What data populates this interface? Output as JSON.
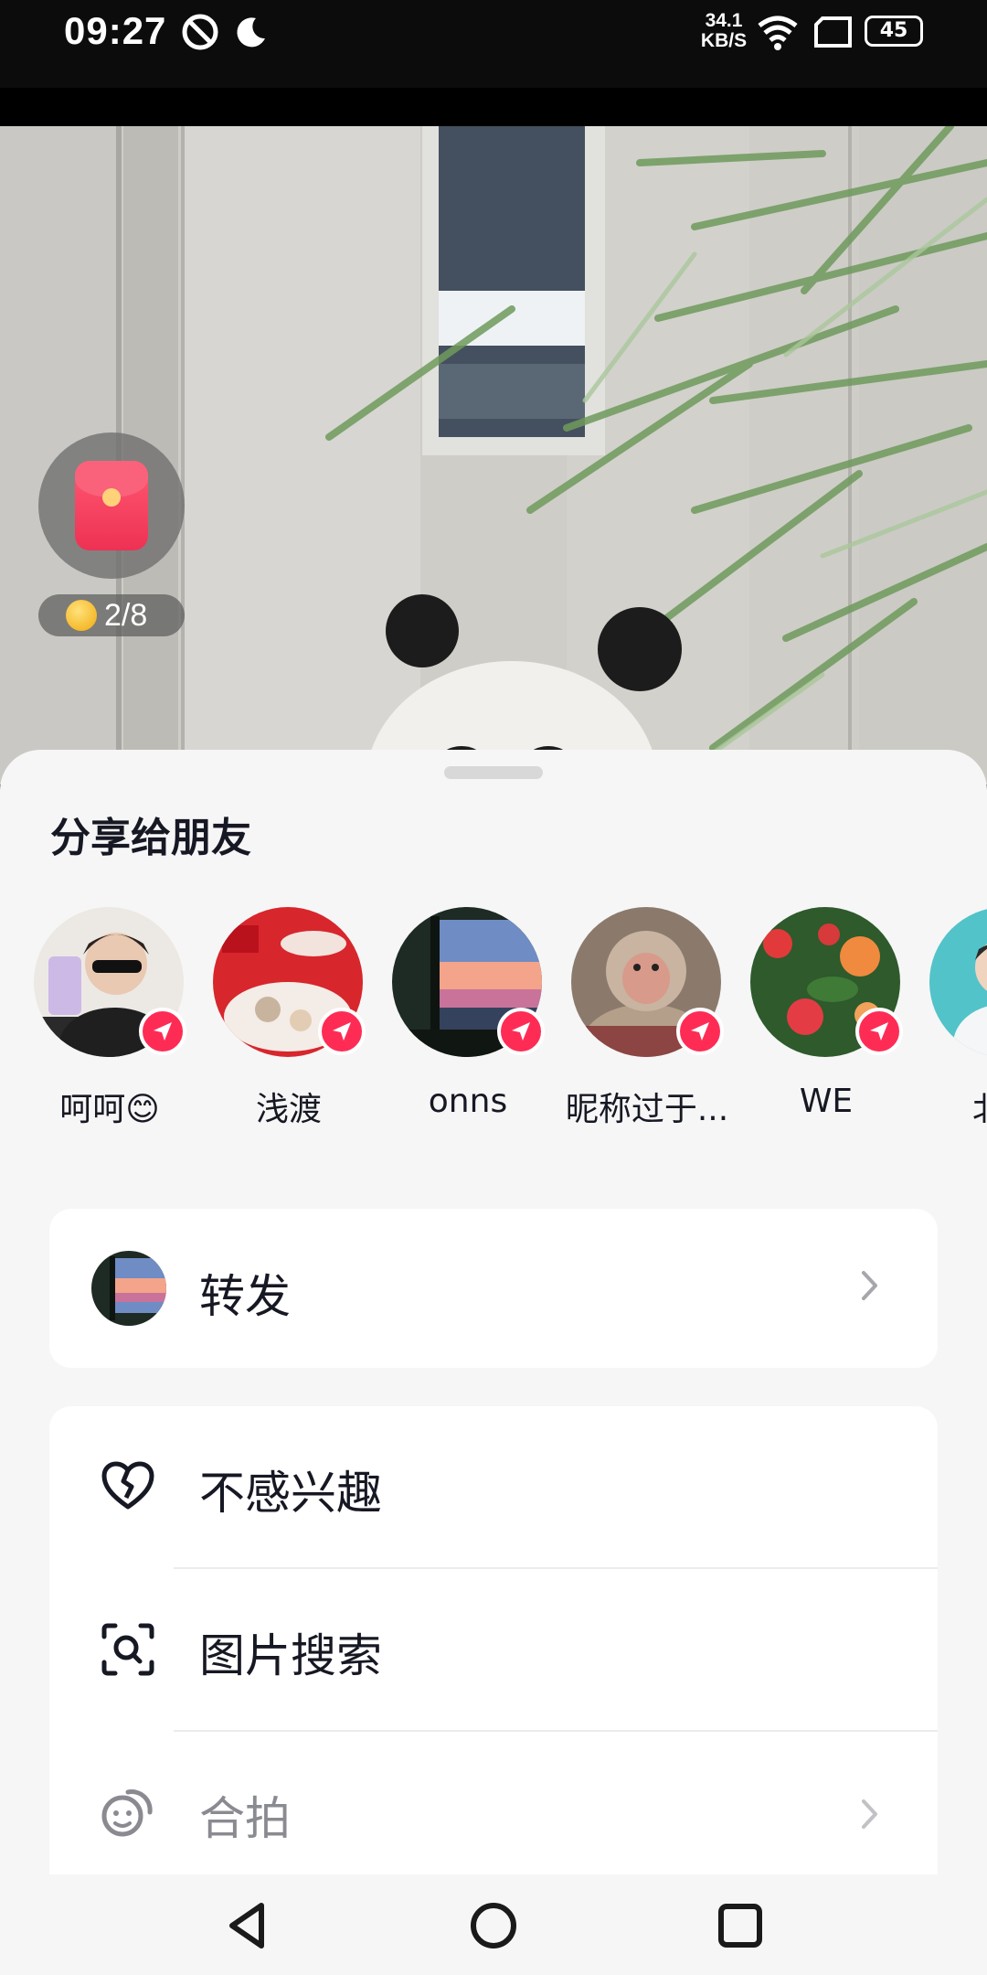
{
  "status_bar": {
    "time": "09:27",
    "net_speed_value": "34.1",
    "net_speed_unit": "KB/S",
    "battery": "45",
    "icons": [
      "do-not-disturb-icon",
      "moon-icon",
      "wifi-icon",
      "screen-icon",
      "battery-icon"
    ]
  },
  "red_packet": {
    "progress": "2/8"
  },
  "sheet": {
    "title": "分享给朋友",
    "friends": [
      {
        "name": "呵呵😊"
      },
      {
        "name": "浅渡"
      },
      {
        "name": "onns"
      },
      {
        "name": "昵称过于..."
      },
      {
        "name": "WE"
      },
      {
        "name": "北京"
      }
    ],
    "forward_label": "转发",
    "menu": [
      {
        "label": "不感兴趣",
        "icon": "broken-heart-icon"
      },
      {
        "label": "图片搜索",
        "icon": "image-search-icon"
      },
      {
        "label": "合拍",
        "icon": "duet-icon"
      }
    ]
  },
  "colors": {
    "accent": "#fe2c55",
    "sheet_bg": "#f6f6f6",
    "text": "#161823",
    "dim_text": "#8a8b91"
  },
  "nav": {
    "buttons": [
      "back-icon",
      "home-icon",
      "recents-icon"
    ]
  }
}
